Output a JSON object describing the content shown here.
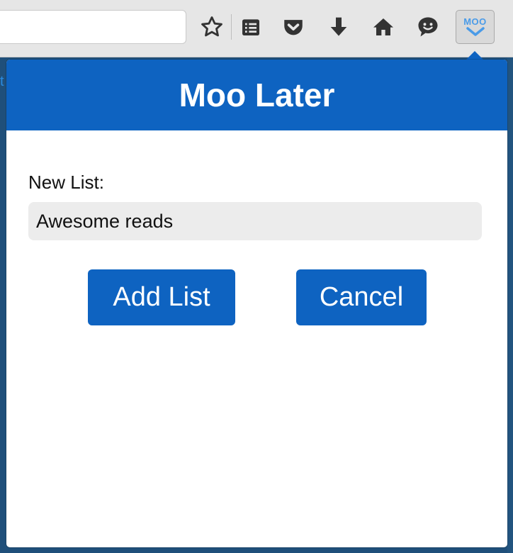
{
  "browser": {
    "toolbar_icons": [
      "star-icon",
      "reading-list-icon",
      "pocket-icon",
      "download-icon",
      "home-icon",
      "chat-icon"
    ],
    "extension_button": {
      "label": "MOO",
      "icon": "chevron-down-icon"
    },
    "background_link_fragment": "t"
  },
  "popup": {
    "title": "Moo Later",
    "field_label": "New List:",
    "input_value": "Awesome reads",
    "add_button": "Add List",
    "cancel_button": "Cancel"
  },
  "colors": {
    "accent": "#0e63c1",
    "input_bg": "#ececec",
    "toolbar_bg": "#e6e6e6",
    "moo_label": "#4a9be8"
  }
}
